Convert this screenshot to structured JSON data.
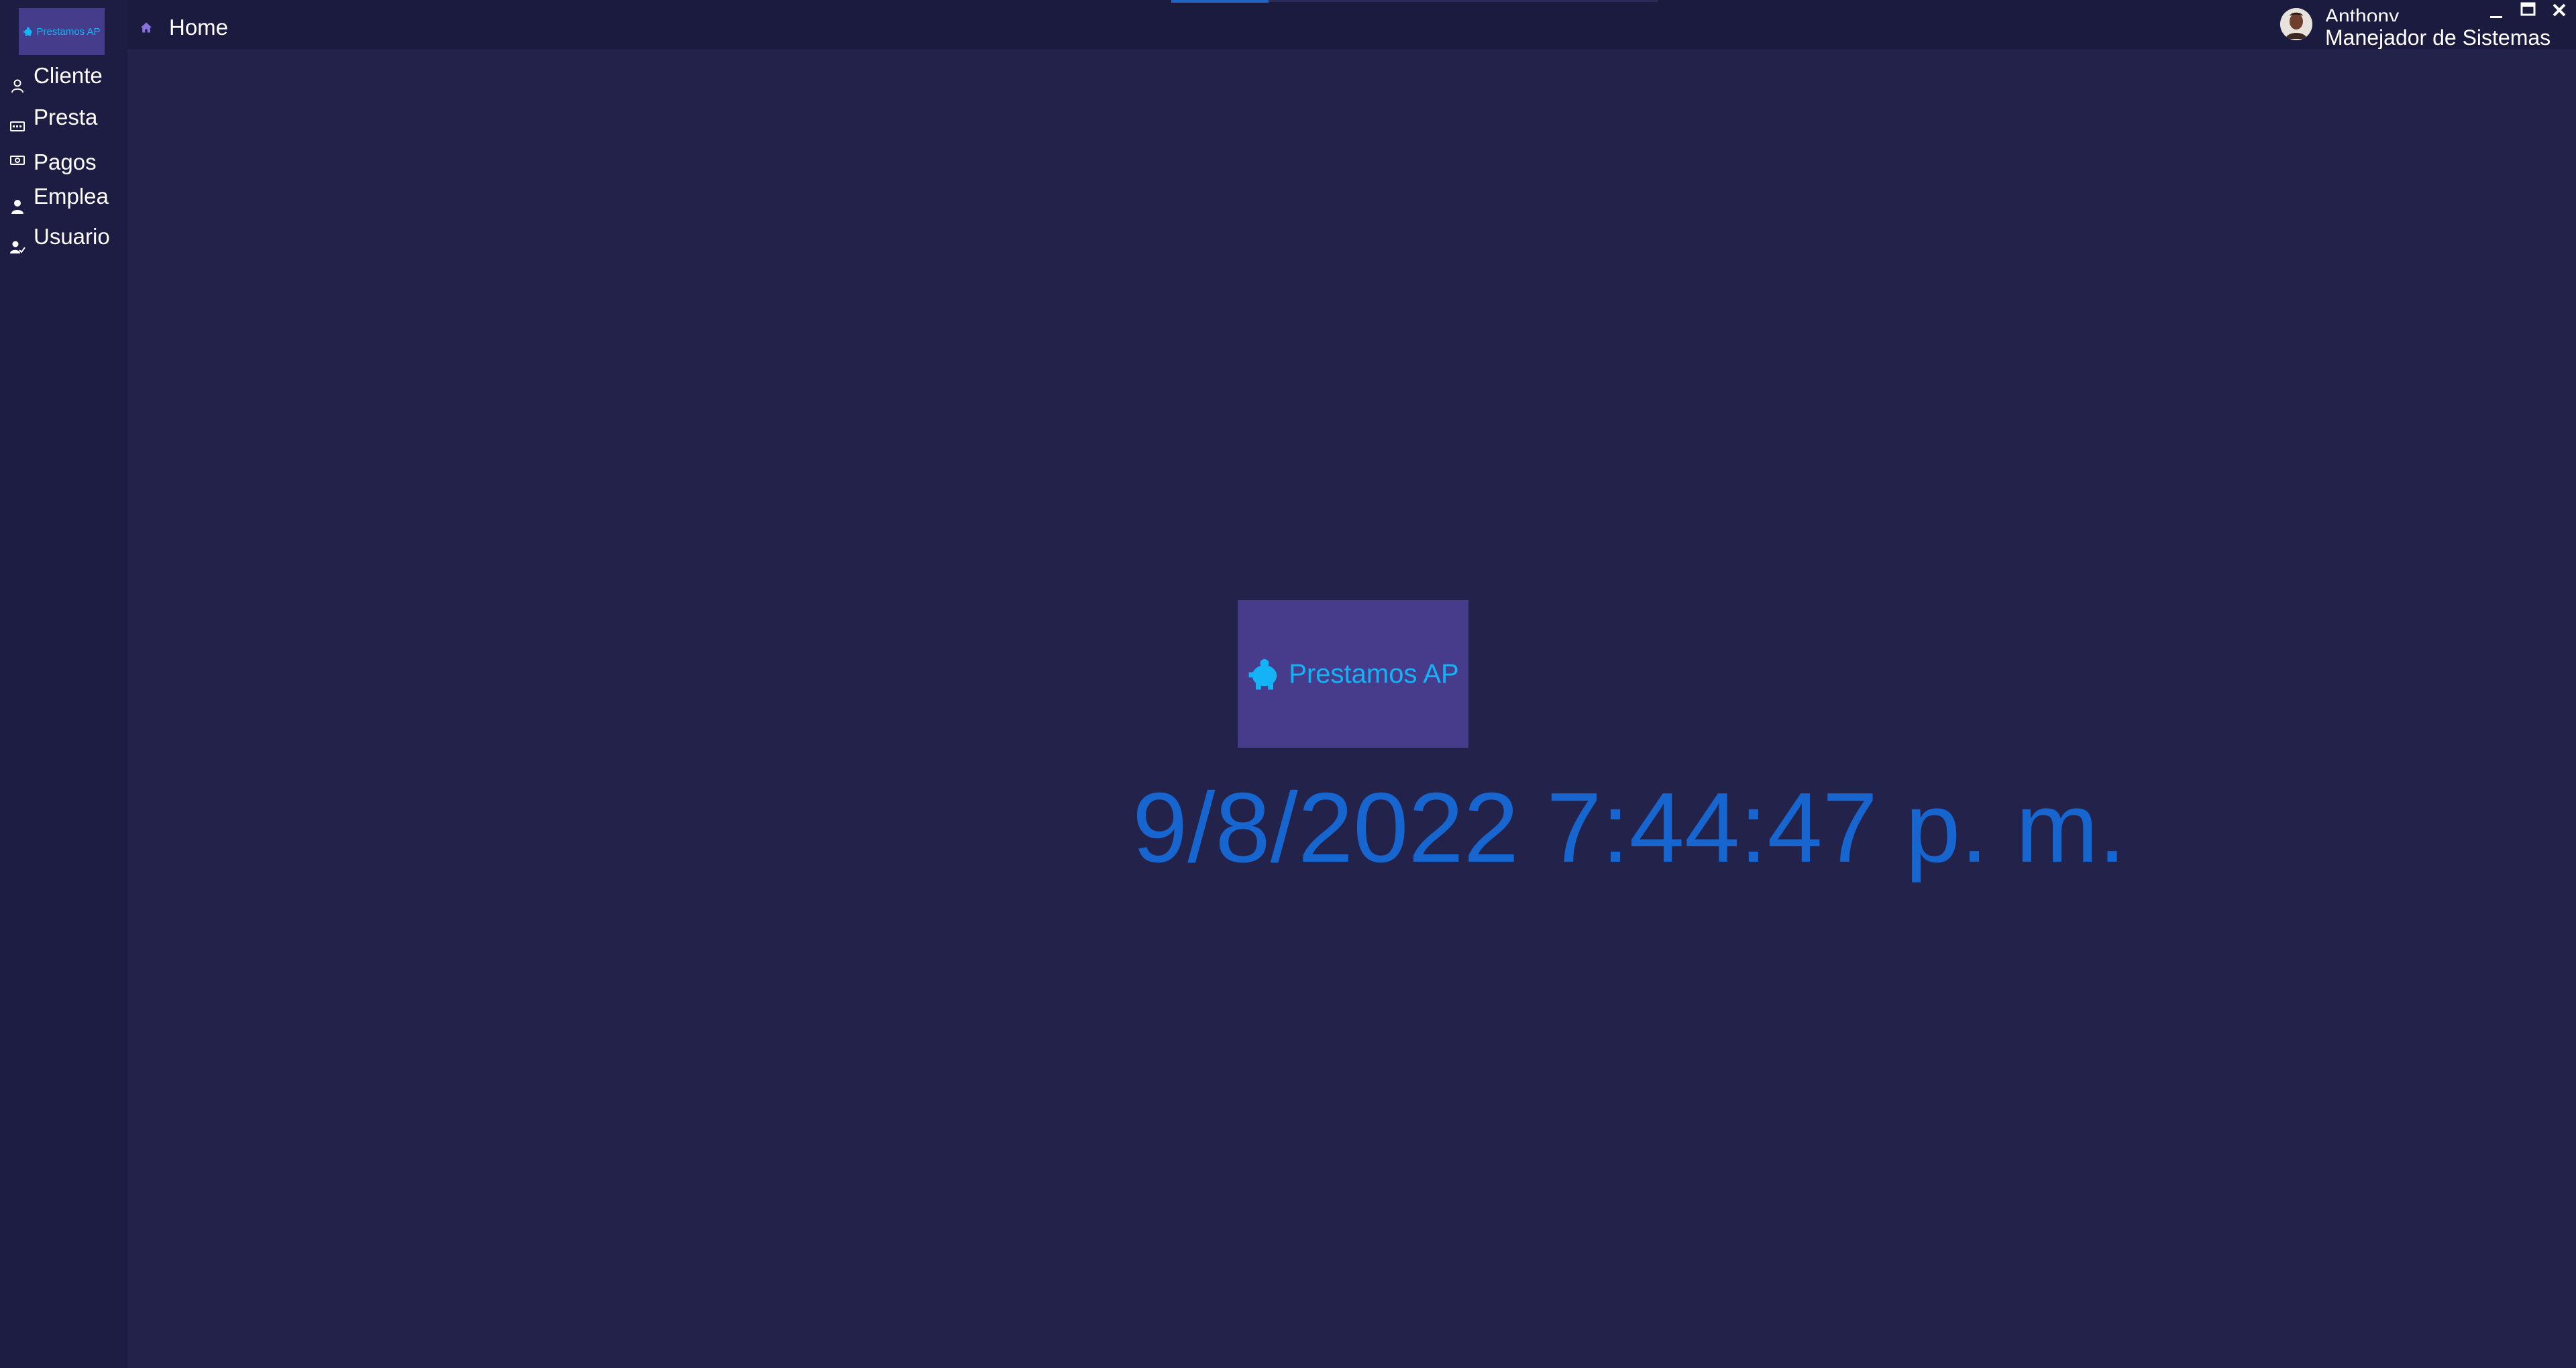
{
  "app": {
    "brand_name": "Prestamos AP",
    "accent_color": "#1f66c7",
    "logo_color": "#13b3f5"
  },
  "sidebar": {
    "items": [
      {
        "label": "Cliente",
        "icon": "user-icon"
      },
      {
        "label": "Presta",
        "icon": "card-icon"
      },
      {
        "label": "Pagos",
        "icon": "money-icon"
      },
      {
        "label": "Emplea",
        "icon": "employee-icon"
      },
      {
        "label": "Usuario",
        "icon": "user-check-icon"
      }
    ]
  },
  "header": {
    "breadcrumb": "Home",
    "breadcrumb_icon": "home-icon",
    "user": {
      "name": "Anthony",
      "role": "Manejador de Sistemas"
    },
    "window_controls": [
      "minimize-icon",
      "maximize-icon",
      "close-icon"
    ]
  },
  "main": {
    "clock_text": "9/8/2022 7:44:47 p. m."
  }
}
